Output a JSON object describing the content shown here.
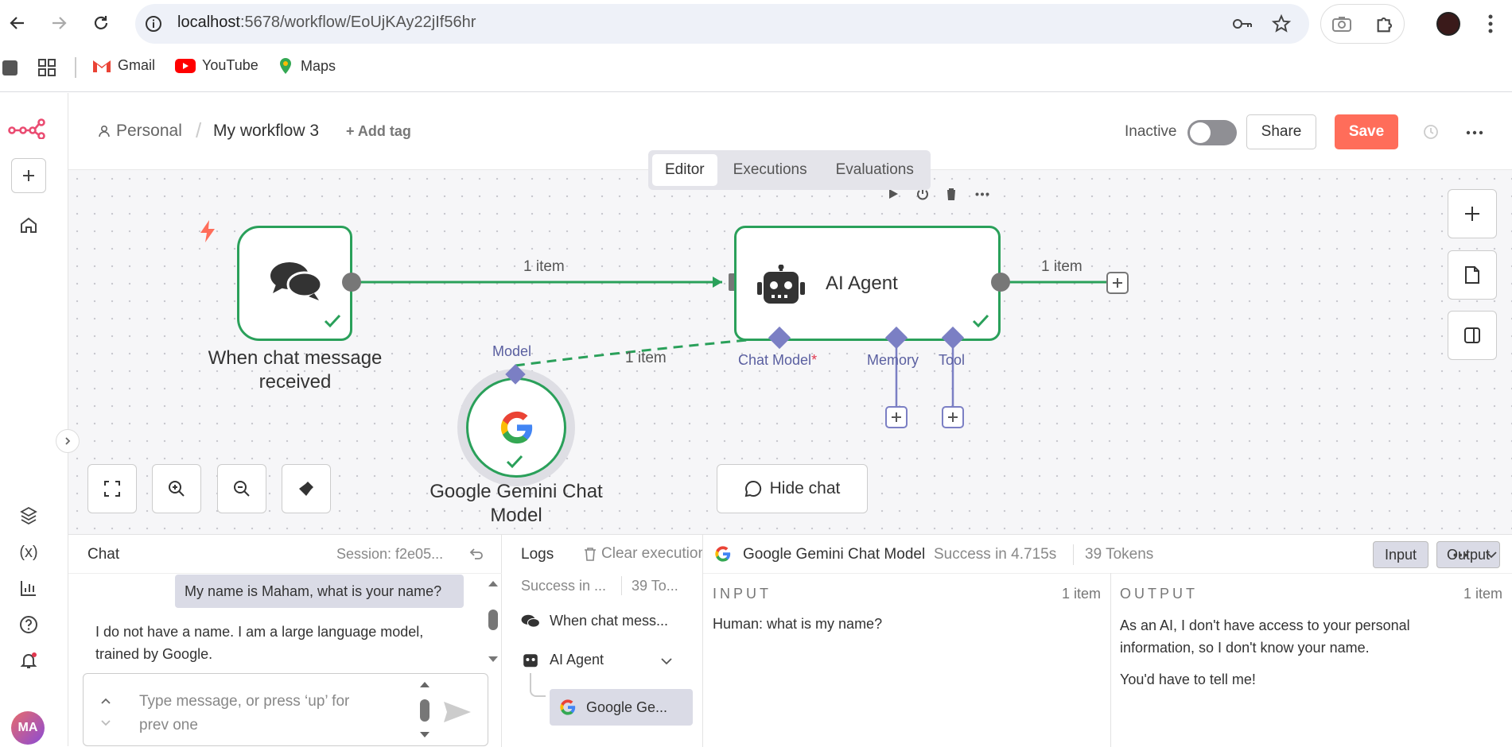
{
  "browser": {
    "url_host": "localhost",
    "url_path": ":5678/workflow/EoUjKAy22jIf56hr",
    "bookmarks": [
      {
        "label": "Gmail"
      },
      {
        "label": "YouTube"
      },
      {
        "label": "Maps"
      }
    ]
  },
  "header": {
    "breadcrumb_personal": "Personal",
    "workflow_name": "My workflow 3",
    "add_tag": "+ Add tag",
    "status_label": "Inactive",
    "share_label": "Share",
    "save_label": "Save"
  },
  "tabs": [
    "Editor",
    "Executions",
    "Evaluations"
  ],
  "canvas": {
    "edge1_label": "1 item",
    "edge2_label": "1 item",
    "edge3_label": "1 item",
    "trigger_title": "When chat message received",
    "agent_title": "AI Agent",
    "model_title": "Google Gemini Chat Model",
    "port_model": "Model",
    "port_chat_model": "Chat Model",
    "port_required": "*",
    "port_memory": "Memory",
    "port_tool": "Tool",
    "hide_chat": "Hide chat"
  },
  "chat": {
    "title": "Chat",
    "session": "Session: f2e05...",
    "user_message": "My name is Maham, what is your name?",
    "bot_message": "I do not have a name. I am a large language model, trained by Google.",
    "input_placeholder": "Type message, or press ‘up’ for prev one"
  },
  "logs": {
    "title": "Logs",
    "clear": "Clear execution",
    "summary_status": "Success in ...",
    "summary_tokens": "39 To...",
    "items": [
      {
        "label": "When chat mess..."
      },
      {
        "label": "AI Agent"
      },
      {
        "label": "Google Ge..."
      }
    ]
  },
  "detail": {
    "node_name": "Google Gemini Chat Model",
    "status": "Success in 4.715s",
    "tokens": "39 Tokens",
    "input_toggle": "Input",
    "output_toggle": "Output",
    "input_heading": "INPUT",
    "input_count": "1 item",
    "input_text": "Human: what is my name?",
    "output_heading": "OUTPUT",
    "output_count": "1 item",
    "output_text_1": "As an AI, I don't have access to your personal information, so I don't know your name.",
    "output_text_2": "You'd have to tell me!"
  },
  "user": {
    "initials": "MA"
  },
  "colors": {
    "accent": "#ff6d5a",
    "success": "#2aa05a",
    "port": "#7b7fc4",
    "brand": "#ea4b71"
  }
}
